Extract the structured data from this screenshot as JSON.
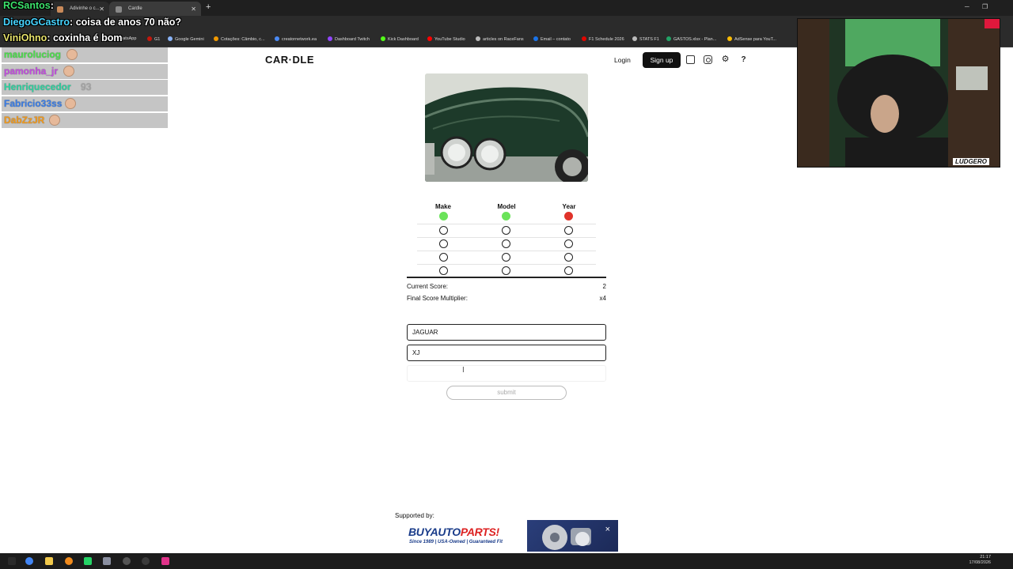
{
  "browser": {
    "tabs": [
      {
        "label": "Adivinhe o c..."
      },
      {
        "label": "Cardle"
      }
    ],
    "bookmarks": [
      {
        "label": "WhatsApp",
        "color": "#25d366"
      },
      {
        "label": "G1",
        "color": "#c4170c"
      },
      {
        "label": "Google Gemini",
        "color": "#8ab4f8"
      },
      {
        "label": "Cotações: Câmbio, c...",
        "color": "#f29900"
      },
      {
        "label": "creatornetwork.ea",
        "color": "#4a8af4"
      },
      {
        "label": "Dashboard Twitch",
        "color": "#9146ff"
      },
      {
        "label": "Kick Dashboard",
        "color": "#53fc18"
      },
      {
        "label": "YouTube Studio",
        "color": "#ff0000"
      },
      {
        "label": "articles on RaceFans",
        "color": "#bbbbbb"
      },
      {
        "label": "Email – contato",
        "color": "#1a73e8"
      },
      {
        "label": "F1 Schedule 2026",
        "color": "#e10600"
      },
      {
        "label": "STATS F1",
        "color": "#bbbbbb"
      },
      {
        "label": "GASTOS.xlsx - Plan...",
        "color": "#21a366"
      },
      {
        "label": "AdSense para YouT...",
        "color": "#fbbc04"
      }
    ]
  },
  "chat": {
    "lines": [
      {
        "user": "RCSantos",
        "msg": ""
      },
      {
        "user": "DiegoGCastro",
        "msg": "coisa de anos 70 não?"
      },
      {
        "user": "ViniOhno",
        "msg": "coxinha é bom"
      }
    ],
    "viewers": [
      {
        "name": "mauroluciog",
        "color": "#4be04b"
      },
      {
        "name": "pamonha_jr",
        "color": "#c34ee0"
      },
      {
        "name": "Henriquecedor",
        "color": "#2fd2a0",
        "count": "93"
      },
      {
        "name": "Fabricio33ss",
        "color": "#3a7ee8"
      },
      {
        "name": "DabZzJR",
        "color": "#f29a1c"
      }
    ]
  },
  "header": {
    "logo": "CAR·DLE",
    "login": "Login",
    "signup": "Sign up",
    "icons": [
      "stats-icon",
      "instagram-icon",
      "gear-icon",
      "help-icon"
    ],
    "help_label": "?"
  },
  "game": {
    "columns": [
      "Make",
      "Model",
      "Year"
    ],
    "guesses": [
      [
        "correct",
        "correct",
        "wrong"
      ],
      [
        "empty",
        "empty",
        "empty"
      ],
      [
        "empty",
        "empty",
        "empty"
      ],
      [
        "empty",
        "empty",
        "empty"
      ],
      [
        "empty",
        "empty",
        "empty"
      ]
    ],
    "status_colors": {
      "correct": "#6be35a",
      "wrong": "#e0332a"
    },
    "score": {
      "current_label": "Current Score:",
      "current_value": "2",
      "multiplier_label": "Final Score Multiplier:",
      "multiplier_value": "x4"
    },
    "inputs": {
      "make": "JAGUAR",
      "model": "XJ",
      "year": ""
    },
    "submit": "submit"
  },
  "footer": {
    "supported_by": "Supported by:",
    "ad_brand_a": "BUYAUTO",
    "ad_brand_b": "PARTS!",
    "ad_tagline": "Since 1989 | USA-Owned | Guaranteed Fit",
    "ad_close": "×"
  },
  "webcam": {
    "logo": "LUDGERO"
  },
  "taskbar": {
    "time": "21:17",
    "date": "17/08/2026"
  }
}
